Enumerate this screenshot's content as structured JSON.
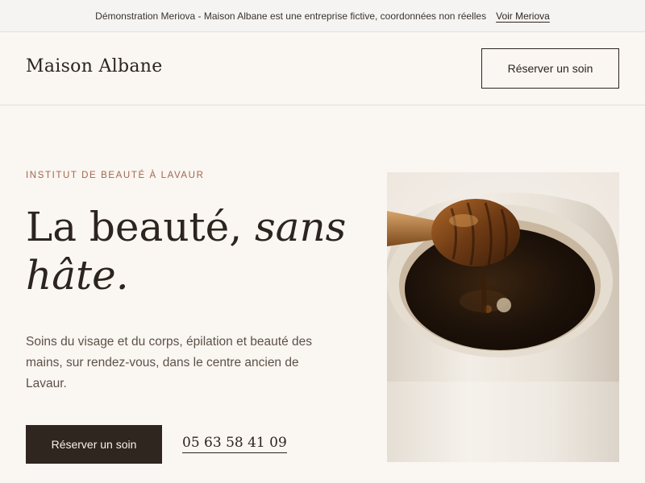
{
  "topbar": {
    "notice": "Démonstration Meriova - Maison Albane est une entreprise fictive, coordonnées non réelles",
    "link": "Voir Meriova"
  },
  "header": {
    "logo": "Maison Albane",
    "cta": "Réserver un soin"
  },
  "hero": {
    "eyebrow": "INSTITUT DE BEAUTÉ À LAVAUR",
    "headline_regular": "La beauté,",
    "headline_italic_1": "sans",
    "headline_italic_2": "hâte.",
    "lead": "Soins du visage et du corps, épilation et beauté des mains, sur rendez-vous, dans le centre ancien de Lavaur.",
    "cta": "Réserver un soin",
    "phone": "05 63 58 41 09"
  },
  "image": {
    "subject": "honey dipper in ceramic pot"
  }
}
